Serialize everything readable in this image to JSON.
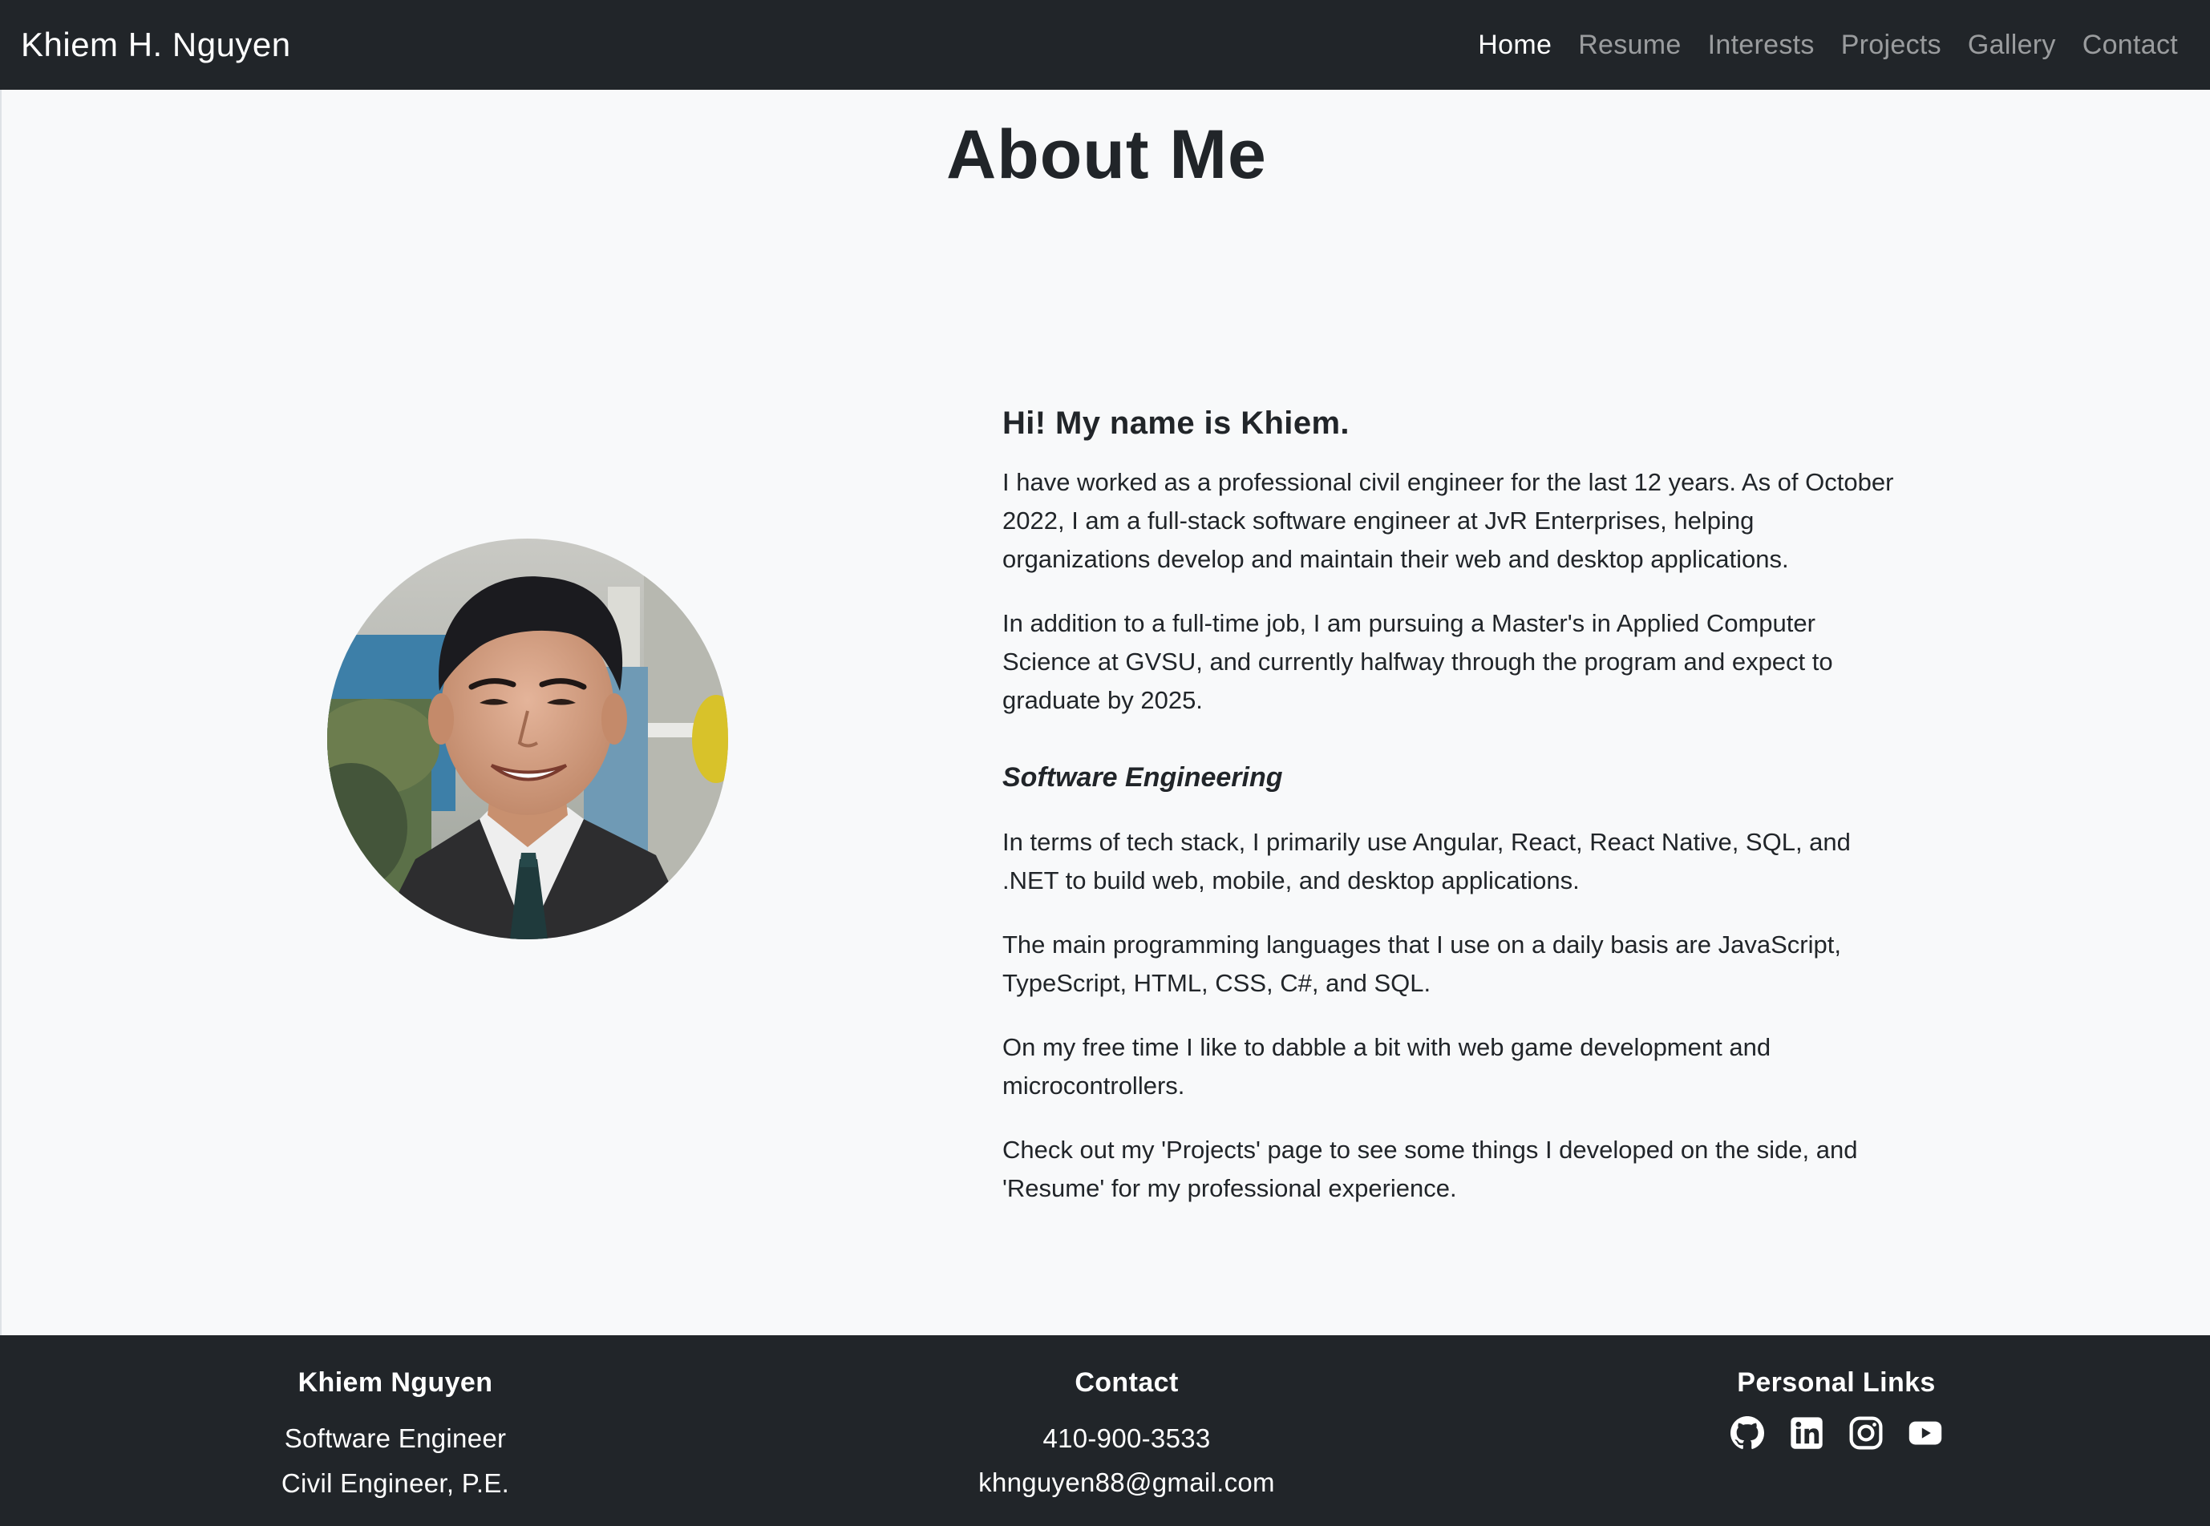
{
  "navbar": {
    "brand": "Khiem H. Nguyen",
    "links": [
      {
        "label": "Home",
        "active": true
      },
      {
        "label": "Resume",
        "active": false
      },
      {
        "label": "Interests",
        "active": false
      },
      {
        "label": "Projects",
        "active": false
      },
      {
        "label": "Gallery",
        "active": false
      },
      {
        "label": "Contact",
        "active": false
      }
    ]
  },
  "main": {
    "title": "About Me",
    "portrait_icon": "profile-photo",
    "greeting": "Hi! My name is Khiem.",
    "intro_paragraphs": [
      "I have worked as a professional civil engineer for the last 12 years. As of October 2022, I am a full-stack software engineer at JvR Enterprises, helping organizations develop and maintain their web and desktop applications.",
      "In addition to a full-time job, I am pursuing a Master's in Applied Computer Science at GVSU, and currently halfway through the program and expect to graduate by 2025."
    ],
    "section_heading": "Software Engineering",
    "section_paragraphs": [
      "In terms of tech stack, I primarily use Angular, React, React Native, SQL, and .NET to build web, mobile, and desktop applications.",
      "The main programming languages that I use on a daily basis are JavaScript, TypeScript, HTML, CSS, C#, and SQL.",
      "On my free time I like to dabble a bit with web game development and microcontrollers.",
      "Check out my 'Projects' page to see some things I developed on the side, and 'Resume' for my professional experience."
    ]
  },
  "footer": {
    "about": {
      "name": "Khiem Nguyen",
      "roles": [
        "Software Engineer",
        "Civil Engineer, P.E."
      ]
    },
    "contact": {
      "heading": "Contact",
      "phone": "410-900-3533",
      "email": "khnguyen88@gmail.com"
    },
    "links": {
      "heading": "Personal Links",
      "icons": [
        "github-icon",
        "linkedin-icon",
        "instagram-icon",
        "youtube-icon"
      ]
    }
  },
  "colors": {
    "nav_bg": "#212529",
    "page_bg": "#f8f9fa",
    "text": "#212529"
  }
}
